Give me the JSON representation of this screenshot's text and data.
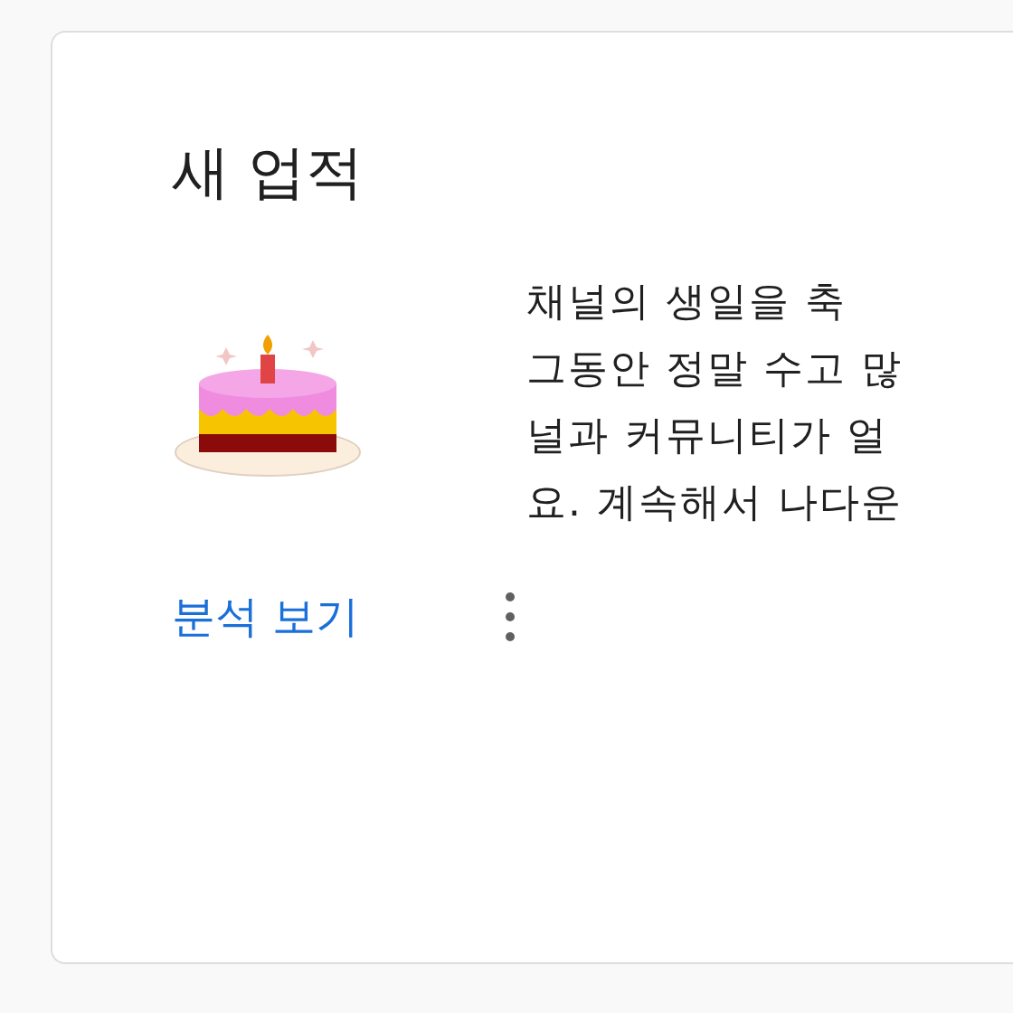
{
  "card": {
    "title": "새 업적",
    "message_lines": [
      "채널의 생일을 축",
      "그동안 정말 수고 많",
      "널과 커뮤니티가 얼",
      "요. 계속해서 나다운"
    ],
    "link": "분석 보기"
  }
}
